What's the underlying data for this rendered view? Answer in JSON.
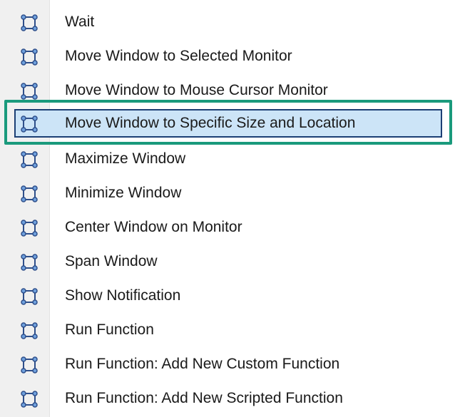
{
  "menu": {
    "items": [
      {
        "label": "Wait",
        "icon": "window-bounds-icon",
        "highlighted": false
      },
      {
        "label": "Move Window to Selected Monitor",
        "icon": "window-bounds-icon",
        "highlighted": false
      },
      {
        "label": "Move Window to Mouse Cursor Monitor",
        "icon": "window-bounds-icon",
        "highlighted": false
      },
      {
        "label": "Move Window to Specific Size and Location",
        "icon": "window-bounds-icon",
        "highlighted": true
      },
      {
        "label": "Maximize Window",
        "icon": "window-bounds-icon",
        "highlighted": false
      },
      {
        "label": "Minimize Window",
        "icon": "window-bounds-icon",
        "highlighted": false
      },
      {
        "label": "Center Window on Monitor",
        "icon": "window-bounds-icon",
        "highlighted": false
      },
      {
        "label": "Span Window",
        "icon": "window-bounds-icon",
        "highlighted": false
      },
      {
        "label": "Show Notification",
        "icon": "window-bounds-icon",
        "highlighted": false
      },
      {
        "label": "Run Function",
        "icon": "window-bounds-icon",
        "highlighted": false
      },
      {
        "label": "Run Function: Add New Custom Function",
        "icon": "window-bounds-icon",
        "highlighted": false
      },
      {
        "label": "Run Function: Add New Scripted Function",
        "icon": "window-bounds-icon",
        "highlighted": false
      }
    ]
  },
  "colors": {
    "icon_stroke": "#2f4f8a",
    "icon_node_fill": "#6fa1de",
    "highlight_background": "#cce4f7",
    "highlight_border": "#1c3f74",
    "callout_border": "#1a9a7c",
    "gutter_background": "#f0f0f0"
  }
}
